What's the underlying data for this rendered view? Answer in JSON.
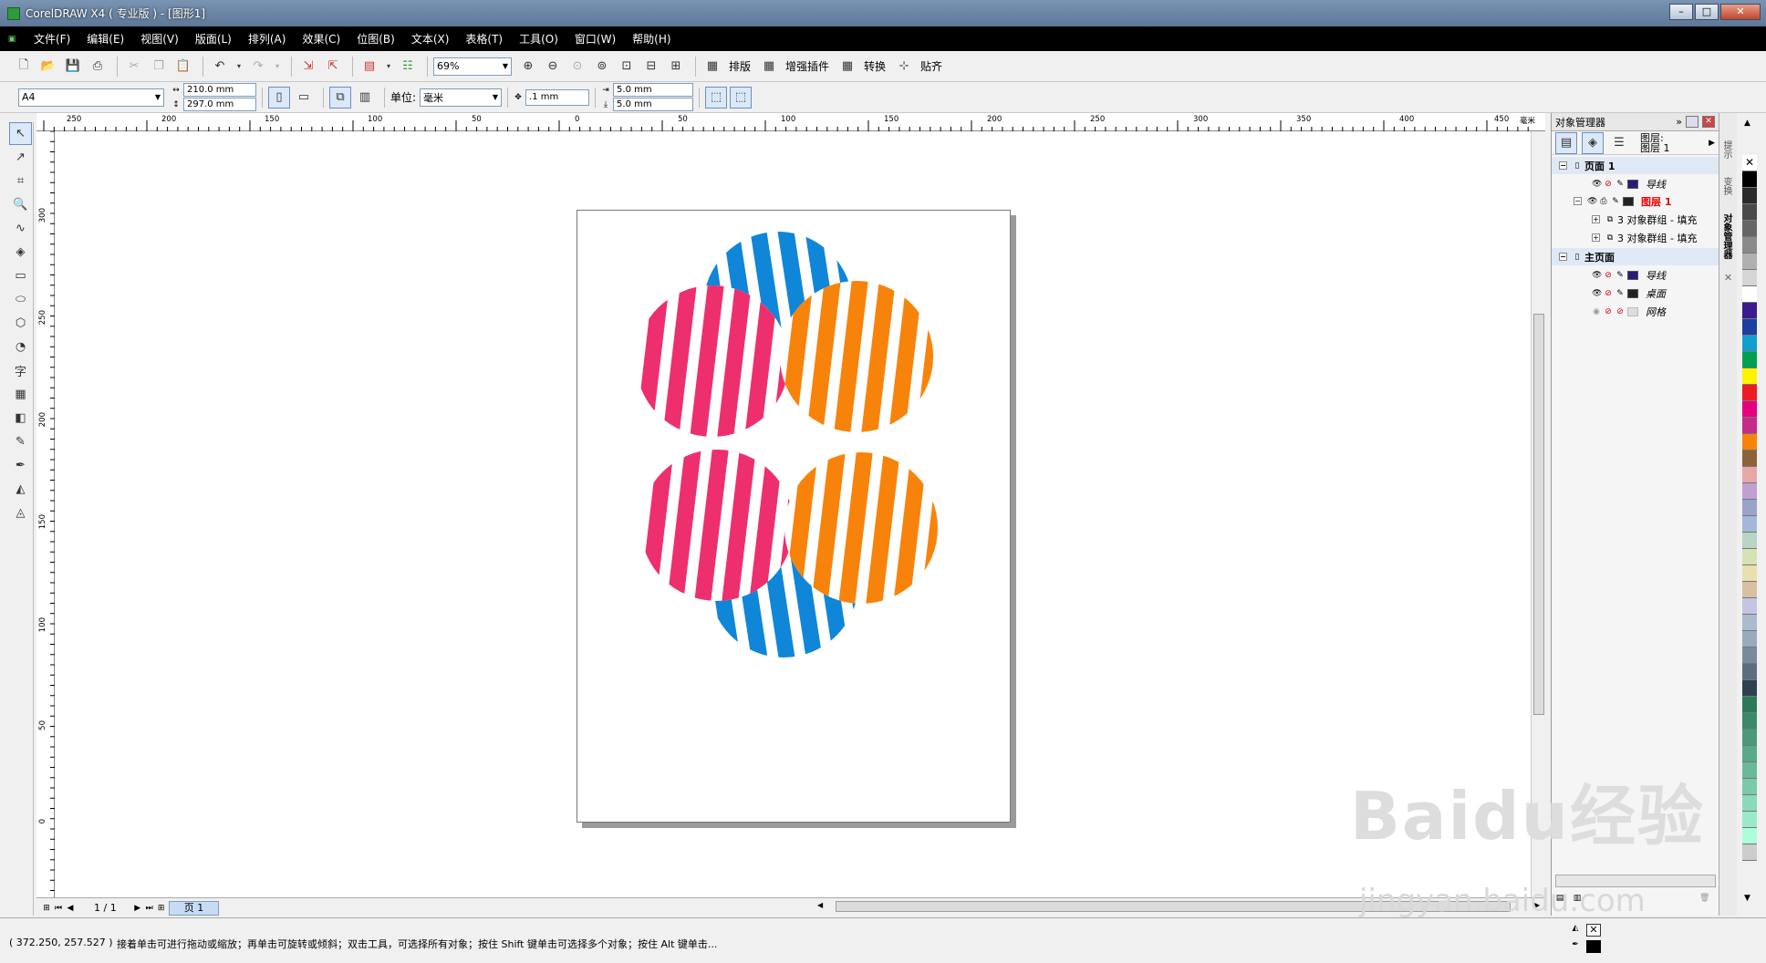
{
  "window": {
    "title": "CorelDRAW X4 ( 专业版 ) - [图形1]",
    "controls": [
      "–",
      "□",
      "✕"
    ]
  },
  "menu": [
    "文件(F)",
    "编辑(E)",
    "视图(V)",
    "版面(L)",
    "排列(A)",
    "效果(C)",
    "位图(B)",
    "文本(X)",
    "表格(T)",
    "工具(O)",
    "窗口(W)",
    "帮助(H)"
  ],
  "doc_controls": [
    "-",
    "∗",
    "×"
  ],
  "toolbar": {
    "zoom": "69%",
    "buttons": [
      "排版",
      "增强插件",
      "转换",
      "贴齐"
    ]
  },
  "property_bar": {
    "paper": "A4",
    "width": "210.0 mm",
    "height": "297.0 mm",
    "unit_label": "单位:",
    "unit": "毫米",
    "nudge": ".1 mm",
    "dup_x": "5.0 mm",
    "dup_y": "5.0 mm"
  },
  "ruler": {
    "h_labels": [
      "250",
      "200",
      "150",
      "100",
      "50",
      "0",
      "50",
      "100",
      "150",
      "200",
      "250",
      "300",
      "350",
      "400",
      "450"
    ],
    "unit_label": "毫米",
    "v_labels": [
      "300",
      "250",
      "200",
      "150",
      "100",
      "50",
      "0"
    ]
  },
  "artwork": {
    "colors": {
      "pink": "#ee2f6e",
      "blue": "#0f86d8",
      "orange": "#f8830b",
      "white": "#ffffff"
    }
  },
  "page_nav": {
    "counter": "1 / 1",
    "tab": "页 1"
  },
  "docker": {
    "title": "对象管理器",
    "layer_label_1": "图层:",
    "layer_label_2": "图层 1",
    "rows": [
      {
        "label": "页面 1",
        "type": "head"
      },
      {
        "label": "导线",
        "type": "layer",
        "color": "#2a1a7a"
      },
      {
        "label": "图层 1",
        "type": "layer-active",
        "color": "#222222"
      },
      {
        "label": "3 对象群组 - 填充",
        "type": "group"
      },
      {
        "label": "3 对象群组 - 填充",
        "type": "group"
      },
      {
        "label": "主页面",
        "type": "head"
      },
      {
        "label": "导线",
        "type": "layer",
        "color": "#2a1a7a"
      },
      {
        "label": "桌面",
        "type": "layer",
        "color": "#222222"
      },
      {
        "label": "网格",
        "type": "layer",
        "color": "#dddddd"
      }
    ],
    "side_tabs": [
      "提示",
      "变换",
      "对象管理器"
    ]
  },
  "status": {
    "coords": "( 372.250, 257.527 )",
    "hint": "接着单击可进行拖动或缩放；再单击可旋转或倾斜；双击工具，可选择所有对象；按住 Shift 键单击可选择多个对象；按住 Alt 键单击..."
  },
  "palette": [
    "#000000",
    "#2b2b2b",
    "#4a4a4a",
    "#666666",
    "#8a8a8a",
    "#b0b0b0",
    "#d5d5d5",
    "#ffffff",
    "#3b1b8f",
    "#1b3fa0",
    "#10a0d0",
    "#00a050",
    "#fff200",
    "#ed1c24",
    "#e4007f",
    "#c42b8b",
    "#f8830b",
    "#8c6239",
    "#e7a7a7",
    "#c0a0d0",
    "#9aa3c8",
    "#a3b8d6",
    "#b8d5c6",
    "#d5e2b4",
    "#e8e0b0",
    "#d8c0a0",
    "#c4c4e4",
    "#aabbcc",
    "#99aabb",
    "#7a8a9a",
    "#5d6d7d",
    "#304050",
    "#2a7a5a",
    "#3a8a6a",
    "#4a9a7a",
    "#5aaa8a",
    "#6aba9a",
    "#7acaaa",
    "#8adaba",
    "#9aeaca",
    "#aaffda",
    "#cccccc"
  ],
  "watermark": {
    "main": "Baidu经验",
    "sub": "jingyan.baidu.com"
  }
}
